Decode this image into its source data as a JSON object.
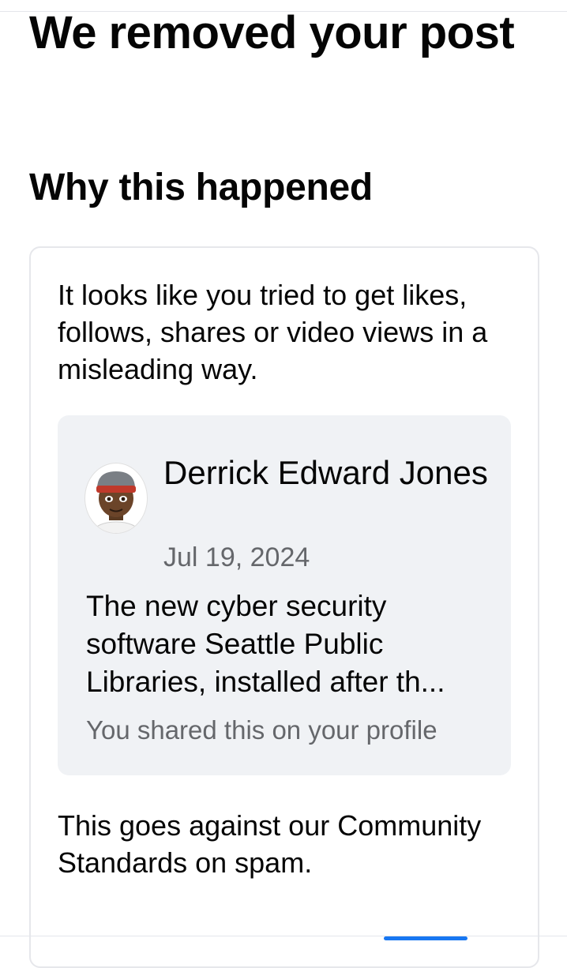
{
  "header": {
    "title": "We removed your post"
  },
  "reason_section": {
    "title": "Why this happened",
    "explanation": "It looks like you tried to get likes, follows, shares or video views in a misleading way.",
    "post": {
      "author": "Derrick Edward Jones",
      "date": "Jul 19, 2024",
      "snippet": "The new cyber security software Seattle Public Libraries, installed after th...",
      "share_note": "You shared this on your profile"
    },
    "policy": "This goes against our Community Standards on spam."
  },
  "colors": {
    "text_primary": "#050505",
    "text_secondary": "#65676b",
    "preview_background": "#f0f2f5",
    "accent": "#1877f2"
  }
}
